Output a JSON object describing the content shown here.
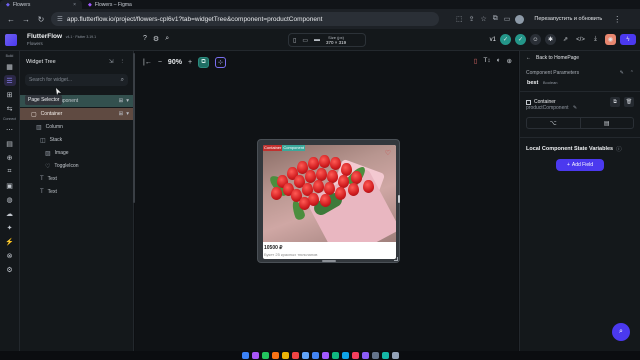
{
  "browser": {
    "tabs": [
      {
        "label": "Flowers",
        "active": true
      },
      {
        "label": "Flowers – Figma",
        "active": false
      }
    ],
    "url": "app.flutterflow.io/project/flowers-cpl6v1?tab=widgetTree&component=productComponent",
    "update_label": "Перезапустить и обновить"
  },
  "topbar": {
    "app_name": "FlutterFlow",
    "version": "v4.1 · Flutter 3.19.1",
    "project": "Flowers",
    "size_label": "Size (px)",
    "size_value": "370 × 319",
    "version_select": "v1"
  },
  "rail": {
    "sections": [
      "Build",
      "Connect"
    ]
  },
  "widget_tree": {
    "title": "Widget Tree",
    "search_placeholder": "Search for widget...",
    "tooltip": "Page Selector",
    "nodes": [
      {
        "label": "productComponent",
        "indent": 0
      },
      {
        "label": "Container",
        "indent": 1
      },
      {
        "label": "Column",
        "indent": 2
      },
      {
        "label": "Stack",
        "indent": 3
      },
      {
        "label": "Image",
        "indent": 4
      },
      {
        "label": "ToggleIcon",
        "indent": 4
      },
      {
        "label": "Text",
        "indent": 3
      },
      {
        "label": "Text",
        "indent": 3
      }
    ]
  },
  "canvas": {
    "zoom": "90%",
    "chip_a": "Container",
    "chip_b": "Component",
    "price": "10500 ₽",
    "description": "Букет 25 красных тюльпанов"
  },
  "props": {
    "back_label": "Back to HomePage",
    "section_title": "Component Parameters",
    "param_name": "best",
    "param_type": "Boolean",
    "widget_label": "Container",
    "component_name": "productComponent",
    "state_title": "Local Component State Variables",
    "add_field": "Add Field"
  },
  "colors": {
    "accent": "#4b39ef",
    "selected_row": "#5f4a41",
    "component_row": "#33504e",
    "teal": "#249689"
  }
}
